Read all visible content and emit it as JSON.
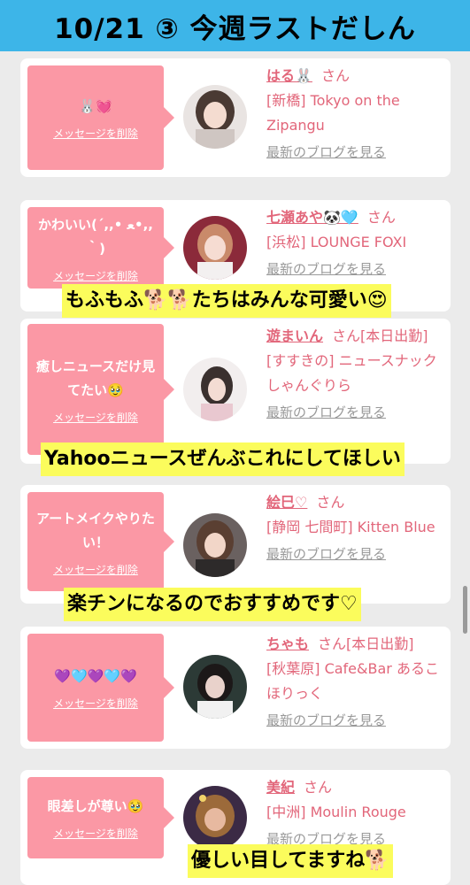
{
  "header": {
    "title": "10/21 ③ 今週ラストだしん"
  },
  "messages": [
    {
      "message": "🐰💓",
      "delete_label": "メッセージを削除",
      "name": "はる🐰",
      "honorific": "さん",
      "area_shop": "[新橋] Tokyo on the Zipangu",
      "blog_link": "最新のブログを見る"
    },
    {
      "message": "かわいい(´,,• ﻌ•,,｀)",
      "delete_label": "メッセージを削除",
      "name": "七瀬あや🐼🩵",
      "honorific": "さん",
      "area_shop": "[浜松] LOUNGE FOXI",
      "blog_link": "最新のブログを見る"
    },
    {
      "message": "癒しニュースだけ見てたい🥹",
      "delete_label": "メッセージを削除",
      "name": "遊まいん",
      "honorific": "さん[本日出勤]",
      "area_shop": "[すすきの] ニュースナックしゃんぐりら",
      "blog_link": "最新のブログを見る"
    },
    {
      "message": "アートメイクやりたい！",
      "delete_label": "メッセージを削除",
      "name": "絵巳♡",
      "honorific": "さん",
      "area_shop": "[静岡 七間町] Kitten Blue",
      "blog_link": "最新のブログを見る"
    },
    {
      "message": "💜🩵💜🩵💜",
      "delete_label": "メッセージを削除",
      "name": "ちゃも",
      "honorific": "さん[本日出勤]",
      "area_shop": "[秋葉原] Cafe&Bar あるこほりっく",
      "blog_link": "最新のブログを見る"
    },
    {
      "message": "眼差しが尊い🥹",
      "delete_label": "メッセージを削除",
      "name": "美紀",
      "honorific": "さん",
      "area_shop": "[中洲] Moulin Rouge",
      "blog_link": "最新のブログを見る"
    }
  ],
  "captions": [
    "もふもふ🐕🐕たちはみんな可愛い😍",
    "Yahooニュースぜんぶこれにしてほしい",
    "楽チンになるのでおすすめです♡",
    "優しい目してますね🐕"
  ],
  "colors": {
    "banner": "#3db5e8",
    "bubble": "#fb98a5",
    "accent": "#e2667a",
    "caption_bg": "#fbfc5c"
  }
}
